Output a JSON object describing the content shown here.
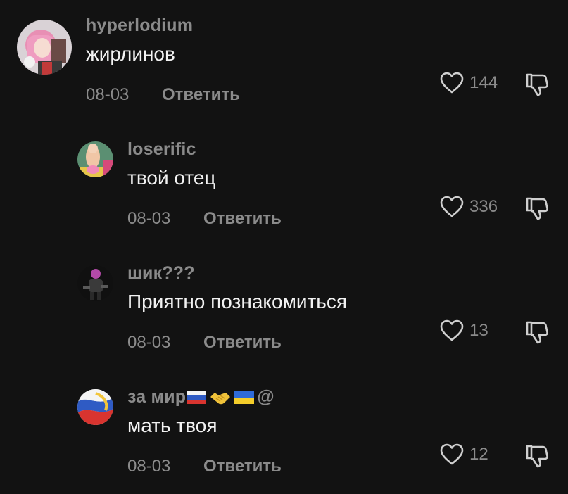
{
  "comments": [
    {
      "username": "hyperlodium",
      "text": "жирлинов",
      "date": "08-03",
      "reply_label": "Ответить",
      "likes": "144",
      "avatar": "anime-girl-avatar"
    },
    {
      "username": "loserific",
      "text": "твой отец",
      "date": "08-03",
      "reply_label": "Ответить",
      "likes": "336",
      "avatar": "plush-toy-avatar"
    },
    {
      "username": "шик???",
      "text": "Приятно познакомиться",
      "date": "08-03",
      "reply_label": "Ответить",
      "likes": "13",
      "avatar": "dark-figure-avatar"
    },
    {
      "username": "за мир",
      "username_suffix": "@",
      "text": "мать твоя",
      "date": "08-03",
      "reply_label": "Ответить",
      "likes": "12",
      "avatar": "flag-swirl-avatar"
    }
  ],
  "icons": {
    "like": "heart-outline-icon",
    "dislike": "thumbs-down-icon"
  },
  "colors": {
    "background": "#121212",
    "primary_text": "#f2f2f2",
    "secondary_text": "#8b8b8b"
  }
}
